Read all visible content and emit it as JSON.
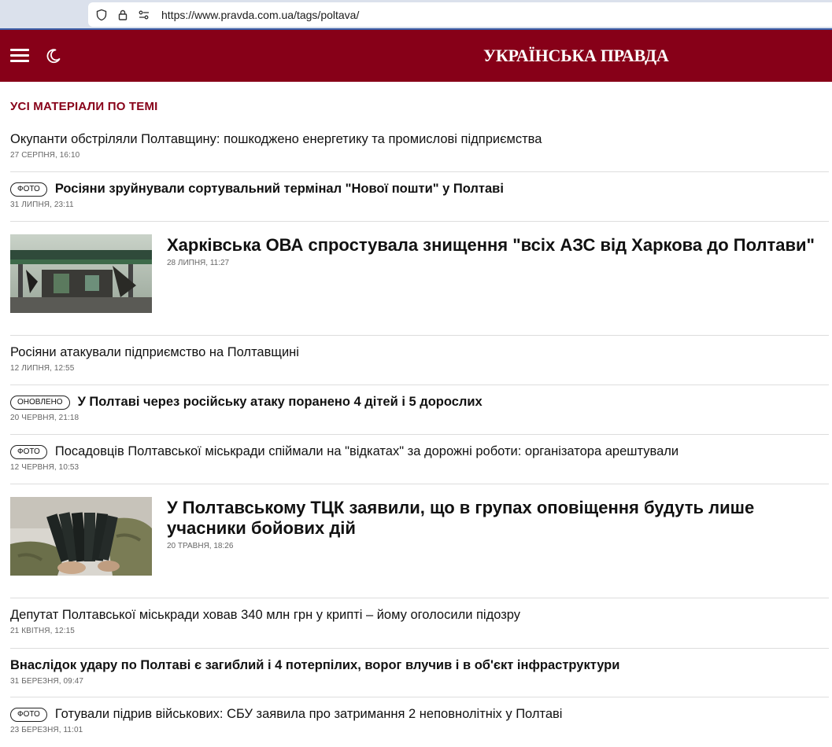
{
  "browser": {
    "url": "https://www.pravda.com.ua/tags/poltava/"
  },
  "header": {
    "logo": "УКРАЇНСЬКА ПРАВДА",
    "brand_color": "#870018"
  },
  "section_title": "УСІ МАТЕРІАЛИ ПО ТЕМІ",
  "articles": [
    {
      "title": "Окупанти обстріляли Полтавщину: пошкоджено енергетику та промислові підприємства",
      "date": "27 СЕРПНЯ, 16:10",
      "badge": "",
      "bold": false
    },
    {
      "title": "Росіяни зруйнували сортувальний термінал \"Нової пошти\" у Полтаві",
      "date": "31 ЛИПНЯ, 23:11",
      "badge": "ФОТО",
      "bold": true
    },
    {
      "title": "Харківська ОВА спростувала знищення \"всіх АЗС від Харкова до Полтави\"",
      "date": "28 ЛИПНЯ, 11:27",
      "badge": "",
      "bold": true,
      "featured": true
    },
    {
      "title": "Росіяни атакували підприємство на Полтавщині",
      "date": "12 ЛИПНЯ, 12:55",
      "badge": "",
      "bold": false
    },
    {
      "title": "У Полтаві через російську атаку поранено 4 дітей і 5 дорослих",
      "date": "20 ЧЕРВНЯ, 21:18",
      "badge": "ОНОВЛЕНО",
      "bold": true
    },
    {
      "title": "Посадовців Полтавської міськради спіймали на \"відкатах\" за дорожні роботи: організатора арештували",
      "date": "12 ЧЕРВНЯ, 10:53",
      "badge": "ФОТО",
      "bold": false
    },
    {
      "title": "У Полтавському ТЦК заявили, що в групах оповіщення будуть лише учасники бойових дій",
      "date": "20 ТРАВНЯ, 18:26",
      "badge": "",
      "bold": true,
      "featured": true
    },
    {
      "title": "Депутат Полтавської міськради ховав 340 млн грн у крипті – йому оголосили підозру",
      "date": "21 КВІТНЯ, 12:15",
      "badge": "",
      "bold": false
    },
    {
      "title": "Внаслідок удару по Полтаві є загиблий і 4 потерпілих, ворог влучив і в об'єкт інфраструктури",
      "date": "31 БЕРЕЗНЯ, 09:47",
      "badge": "",
      "bold": true
    },
    {
      "title": "Готували підрив військових: СБУ заявила про затримання 2 неповнолітніх у Полтаві",
      "date": "23 БЕРЕЗНЯ, 11:01",
      "badge": "ФОТО",
      "bold": false
    }
  ]
}
